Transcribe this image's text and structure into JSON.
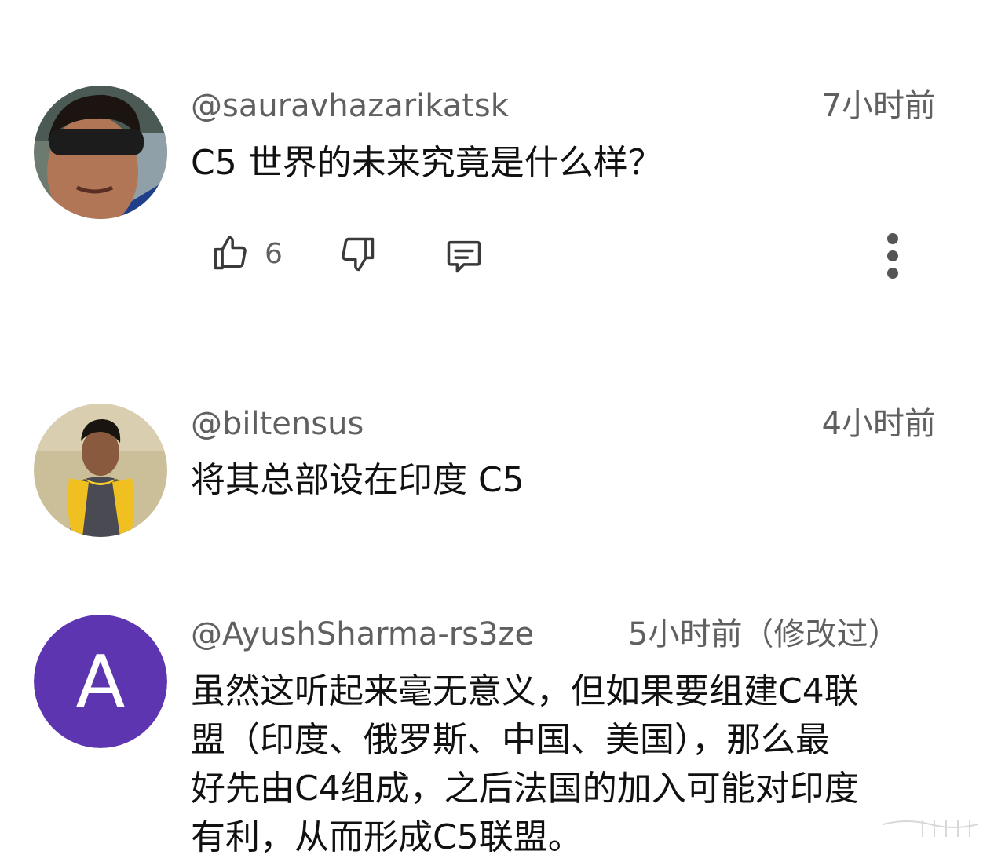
{
  "comments": [
    {
      "author": "@sauravhazarikatsk",
      "time": "7小时前",
      "text": "C5 世界的未来究竟是什么样？",
      "likes": "6",
      "avatar": "photo-man-sunglasses"
    },
    {
      "author": "@biltensus",
      "time": "4小时前",
      "text": "将其总部设在印度 C5",
      "avatar": "photo-child-yellow-scarf"
    },
    {
      "author": "@AyushSharma-rs3ze",
      "time": "5小时前（修改过）",
      "text_lines": [
        "虽然这听起来毫无意义，但如果要组建C4联",
        "盟（印度、俄罗斯、中国、美国），那么最",
        "好先由C4组成，之后法国的加入可能对印度",
        "有利，从而形成C5联盟。"
      ],
      "avatar_letter": "A",
      "avatar_color": "#5e35b1"
    }
  ],
  "icons": {
    "like": "thumb-up-icon",
    "dislike": "thumb-down-icon",
    "reply": "reply-comment-icon",
    "more": "more-vertical-icon"
  },
  "colors": {
    "meta": "#606060",
    "text": "#111111",
    "avatar_purple": "#5e35b1"
  }
}
